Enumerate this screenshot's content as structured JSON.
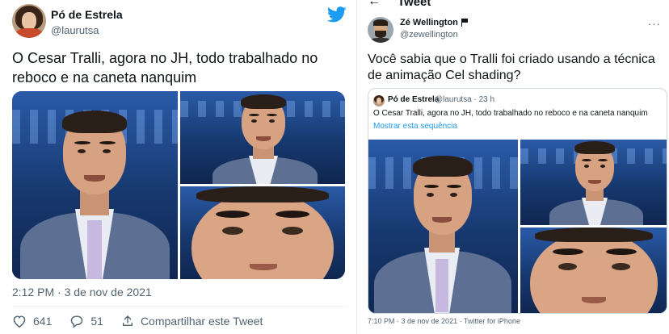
{
  "left_tweet": {
    "author_name": "Pó de Estrela",
    "author_handle": "@laurutsa",
    "text": "O Cesar Tralli, agora no JH, todo trabalhado no reboco e na caneta nanquim",
    "timestamp": "2:12 PM · 3 de nov de 2021",
    "actions": {
      "likes": "641",
      "replies": "51",
      "share_label": "Compartilhar este Tweet"
    },
    "icons": [
      "heart-icon",
      "reply-icon",
      "share-icon",
      "twitter-bird-icon"
    ]
  },
  "right_tweet": {
    "header_title": "Tweet",
    "back_glyph": "←",
    "author_name": "Zé Wellington",
    "author_handle": "@zewellington",
    "more_glyph": "···",
    "text": "Você sabia que o Tralli foi criado usando a técnica de animação Cel shading?",
    "quoted": {
      "author_name": "Pó de Estrela",
      "author_handle": "@laurutsa · 23 h",
      "text": "O Cesar Tralli, agora no JH, todo trabalhado no reboco e na caneta nanquim",
      "show_thread": "Mostrar esta sequência"
    },
    "meta": "7:10 PM · 3 de nov de 2021 · Twitter for iPhone"
  },
  "colors": {
    "accent": "#1d9bf0",
    "secondary_text": "#536471",
    "studio_blue": "#1b3f7a",
    "suit": "#5d6f93"
  }
}
